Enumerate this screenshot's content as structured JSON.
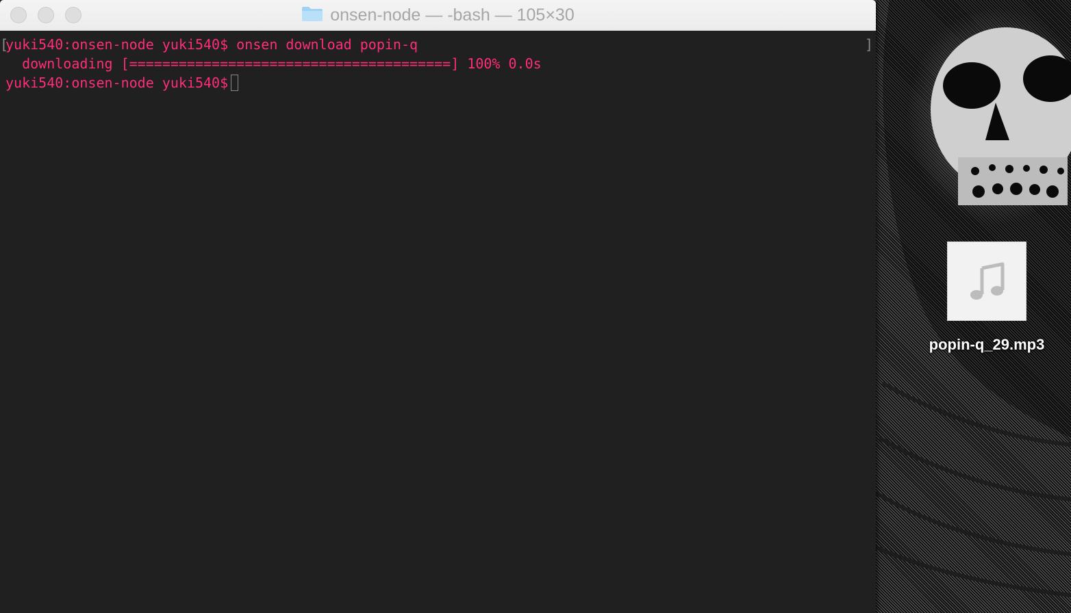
{
  "window": {
    "title": "onsen-node — -bash — 105×30",
    "folder_icon": "folder-icon"
  },
  "terminal": {
    "left_bracket": "[",
    "right_bracket": "]",
    "lines": {
      "command": "yuki540:onsen-node yuki540$ onsen download popin-q",
      "progress": "  downloading [=======================================] 100% 0.0s",
      "prompt": "yuki540:onsen-node yuki540$"
    },
    "text_color": "#ff2d7a",
    "background_color": "#202020"
  },
  "desktop": {
    "file": {
      "name": "popin-q_29.mp3",
      "icon": "music-note-icon"
    }
  }
}
